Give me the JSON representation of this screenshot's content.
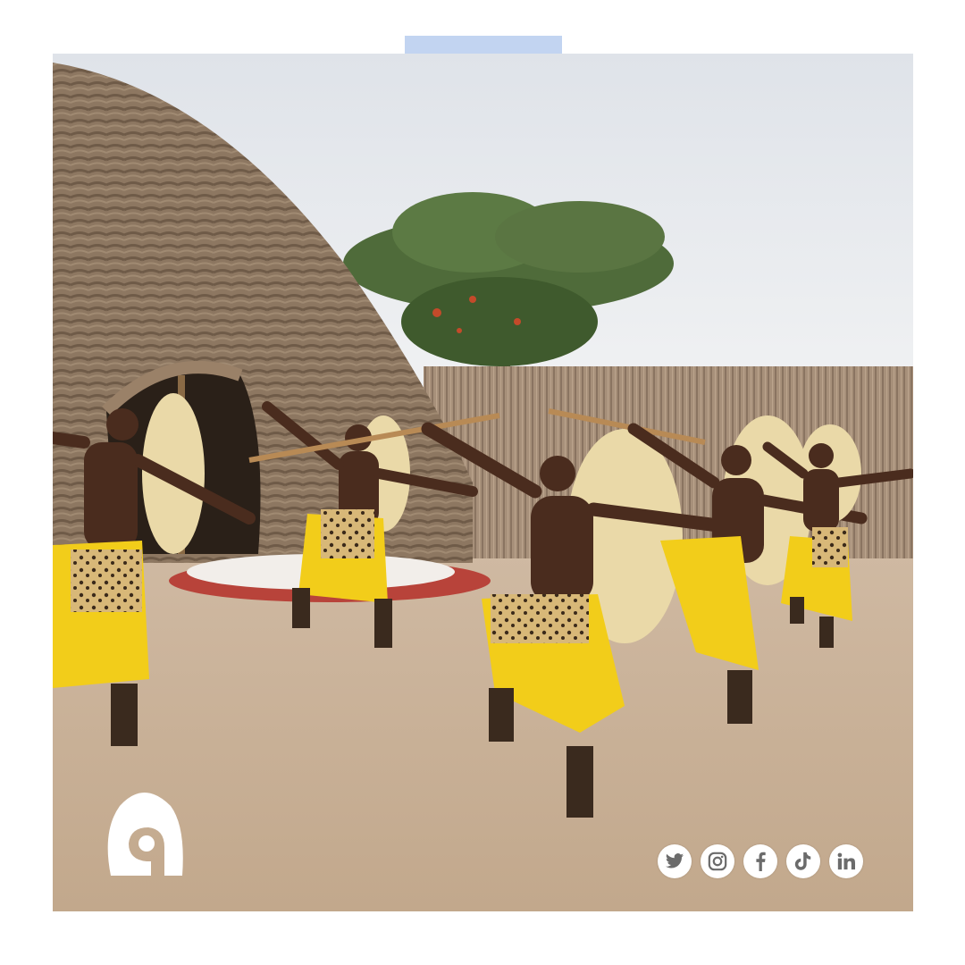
{
  "scene": {
    "subject": "traditional-dancers",
    "sky_color": "#e8eaee",
    "ground_color": "#c9b29a",
    "skirt_color": "#f2cd1a",
    "accent_tab_color": "#c2d4f1"
  },
  "logo": {
    "icon": "brand-logo-icon"
  },
  "social": [
    {
      "icon": "twitter-icon"
    },
    {
      "icon": "instagram-icon"
    },
    {
      "icon": "facebook-icon"
    },
    {
      "icon": "tiktok-icon"
    },
    {
      "icon": "linkedin-icon"
    }
  ]
}
